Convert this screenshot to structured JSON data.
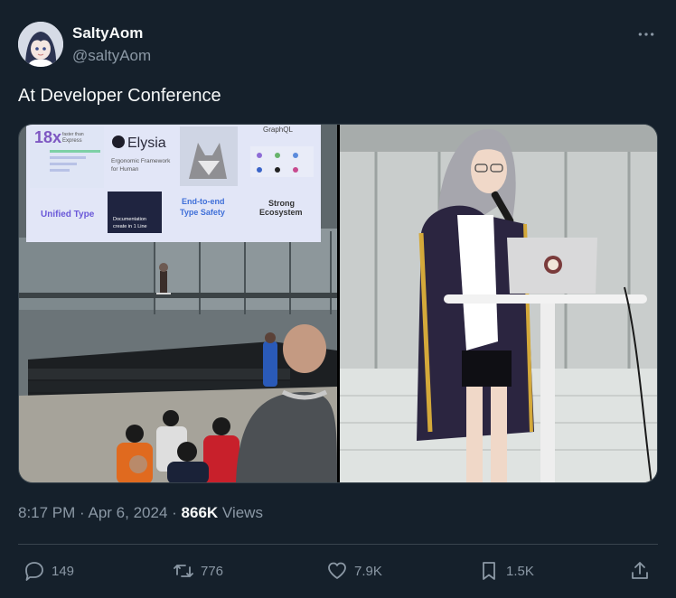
{
  "author": {
    "display_name": "SaltyAom",
    "handle": "@saltyAom"
  },
  "tweet": {
    "text": "At Developer Conference",
    "time": "8:17 PM",
    "date": "Apr 6, 2024",
    "views_count": "866K",
    "views_label": "Views"
  },
  "slide": {
    "speed_number": "18x",
    "speed_caption_1": "faster than",
    "speed_caption_2": "Express",
    "brand": "Elysia",
    "tagline_1": "Ergonomic Framework",
    "tagline_2": "for Human",
    "graphql": "GraphQL",
    "unified_type": "Unified Type",
    "docs_1": "Documentation",
    "docs_2": "create in 1 Line",
    "type_safety_1": "End-to-end",
    "type_safety_2": "Type Safety",
    "ecosystem_1": "Strong",
    "ecosystem_2": "Ecosystem"
  },
  "actions": {
    "replies": "149",
    "retweets": "776",
    "likes": "7.9K",
    "bookmarks": "1.5K"
  },
  "icons": {
    "more": "more-icon",
    "reply": "reply-icon",
    "retweet": "retweet-icon",
    "like": "heart-icon",
    "bookmark": "bookmark-icon",
    "share": "share-icon"
  },
  "colors": {
    "background": "#15202b",
    "text_primary": "#f7f9f9",
    "text_secondary": "#8b98a5",
    "divider": "#38444d"
  }
}
